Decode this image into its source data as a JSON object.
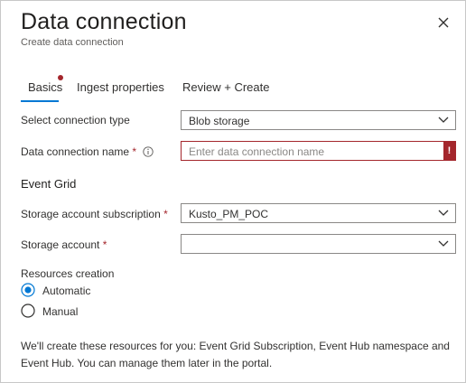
{
  "header": {
    "title": "Data connection",
    "subtitle": "Create data connection"
  },
  "tabs": [
    {
      "label": "Basics"
    },
    {
      "label": "Ingest properties"
    },
    {
      "label": "Review + Create"
    }
  ],
  "form": {
    "connection_type": {
      "label": "Select connection type",
      "value": "Blob storage"
    },
    "connection_name": {
      "label": "Data connection name",
      "required_mark": "*",
      "placeholder": "Enter data connection name",
      "error_mark": "!"
    },
    "event_grid_heading": "Event Grid",
    "subscription": {
      "label": "Storage account subscription",
      "required_mark": "*",
      "value": "Kusto_PM_POC"
    },
    "storage_account": {
      "label": "Storage account",
      "required_mark": "*",
      "value": ""
    },
    "resources_creation": {
      "label": "Resources creation",
      "options": [
        {
          "label": "Automatic",
          "selected": true
        },
        {
          "label": "Manual",
          "selected": false
        }
      ]
    },
    "note": "We'll create these resources for you: Event Grid Subscription, Event Hub namespace and Event Hub. You can manage them later in the portal."
  },
  "icons": {
    "close": "close-icon",
    "info": "info-icon",
    "chevron": "chevron-down-icon"
  },
  "colors": {
    "accent": "#0078d4",
    "error": "#a4262c",
    "text": "#323130"
  }
}
